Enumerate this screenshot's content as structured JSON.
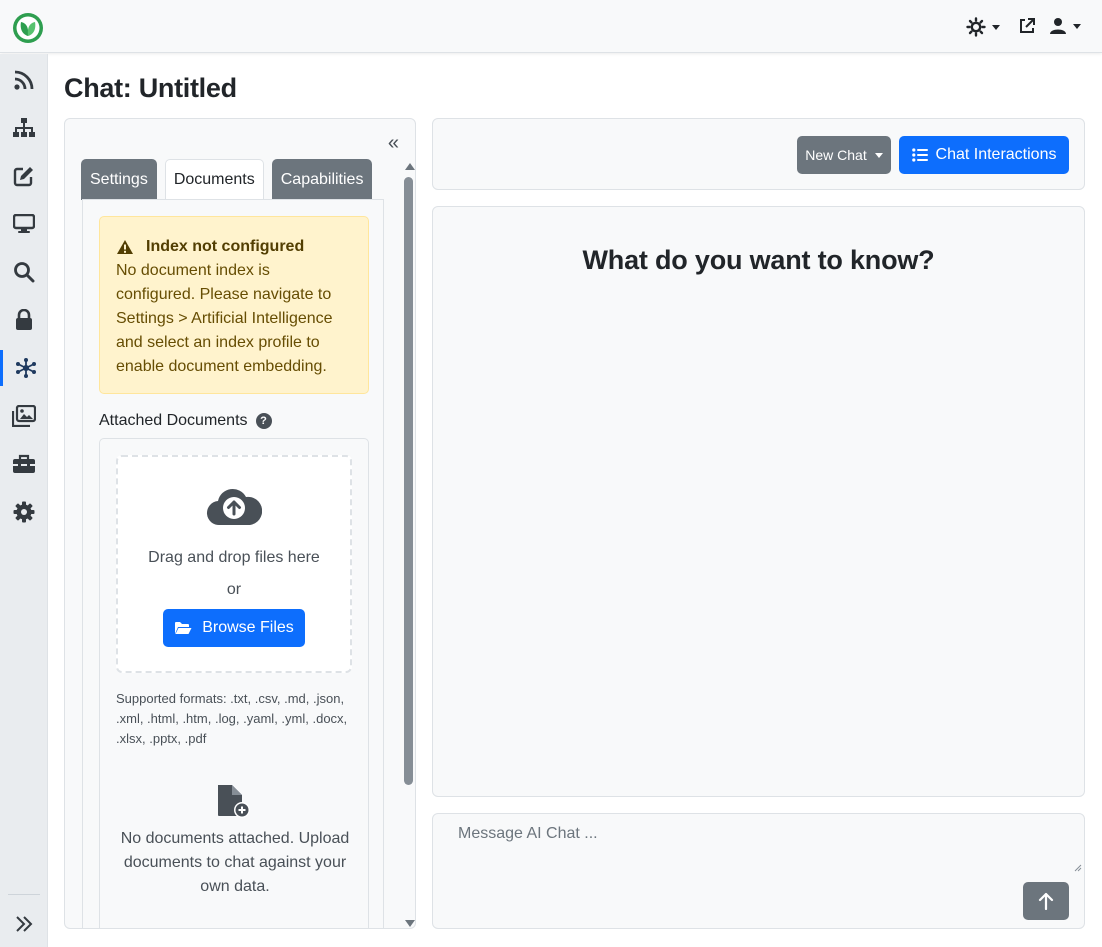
{
  "header": {
    "logo_icon": "leaf-logo-icon",
    "theme_icon": "sun-icon",
    "external_icon": "external-link-icon",
    "user_icon": "user-icon"
  },
  "sidebar": {
    "items": [
      {
        "icon": "rss-icon"
      },
      {
        "icon": "sitemap-icon"
      },
      {
        "icon": "edit-icon"
      },
      {
        "icon": "desktop-icon"
      },
      {
        "icon": "search-icon"
      },
      {
        "icon": "lock-icon"
      },
      {
        "icon": "network-icon",
        "active": true
      },
      {
        "icon": "images-icon"
      },
      {
        "icon": "toolbox-icon"
      },
      {
        "icon": "gear-icon"
      }
    ],
    "expand_icon": "double-chevron-right-icon"
  },
  "page": {
    "title": "Chat: Untitled"
  },
  "left_panel": {
    "collapse_label": "«",
    "tabs": [
      {
        "label": "Settings"
      },
      {
        "label": "Documents",
        "active": true
      },
      {
        "label": "Capabilities"
      }
    ],
    "alert": {
      "title": "Index not configured",
      "body": "No document index is configured. Please navigate to Settings > Artificial Intelligence and select an index profile to enable document embedding."
    },
    "attached_label": "Attached Documents",
    "help_glyph": "?",
    "dropzone": {
      "drag_text": "Drag and drop files here",
      "or_text": "or",
      "browse_label": "Browse Files"
    },
    "formats": "Supported formats: .txt, .csv, .md, .json, .xml, .html, .htm, .log, .yaml, .yml, .docx, .xlsx, .pptx, .pdf",
    "empty_text": "No documents attached. Upload documents to chat against your own data."
  },
  "toolbar": {
    "new_chat_label": "New Chat",
    "interactions_label": "Chat Interactions"
  },
  "chat": {
    "heading": "What do you want to know?"
  },
  "composer": {
    "placeholder": "Message AI Chat ..."
  },
  "colors": {
    "primary": "#0d6efd",
    "secondary": "#6c757d",
    "warning_bg": "#fff3cd",
    "brand_green": "#28a745"
  }
}
